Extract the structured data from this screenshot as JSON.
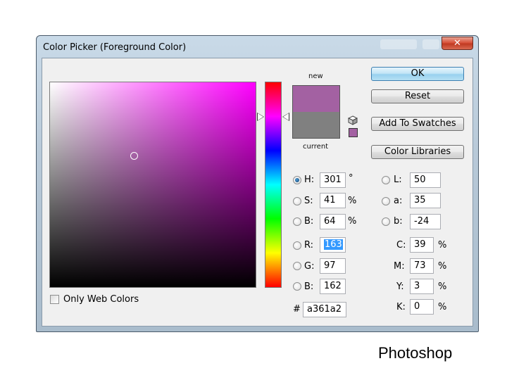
{
  "window": {
    "title": "Color Picker (Foreground Color)",
    "close_symbol": "✕"
  },
  "swatch": {
    "new_label": "new",
    "current_label": "current",
    "new_color": "#a361a2",
    "current_color": "#808080"
  },
  "buttons": {
    "ok": "OK",
    "reset": "Reset",
    "add_to_swatches": "Add To Swatches",
    "color_libraries": "Color Libraries"
  },
  "hsb": {
    "h_label": "H:",
    "h_value": "301",
    "h_unit": "°",
    "s_label": "S:",
    "s_value": "41",
    "s_unit": "%",
    "b_label": "B:",
    "b_value": "64",
    "b_unit": "%"
  },
  "rgb": {
    "r_label": "R:",
    "r_value": "163",
    "g_label": "G:",
    "g_value": "97",
    "b_label": "B:",
    "b_value": "162"
  },
  "lab": {
    "l_label": "L:",
    "l_value": "50",
    "a_label": "a:",
    "a_value": "35",
    "b_label": "b:",
    "b_value": "-24"
  },
  "cmyk": {
    "c_label": "C:",
    "c_value": "39",
    "c_unit": "%",
    "m_label": "M:",
    "m_value": "73",
    "m_unit": "%",
    "y_label": "Y:",
    "y_value": "3",
    "y_unit": "%",
    "k_label": "K:",
    "k_value": "0",
    "k_unit": "%"
  },
  "hex": {
    "label": "#",
    "value": "a361a2"
  },
  "web_colors": {
    "label": "Only Web Colors",
    "checked": false
  },
  "caption": "Photoshop",
  "colors": {
    "field_hue": "#ff00ff",
    "close_red": "#c03a22",
    "ok_blue": "#3c7fb1",
    "selection": "#3399ff"
  },
  "icons": {
    "gamut_cube": "cube-icon"
  }
}
